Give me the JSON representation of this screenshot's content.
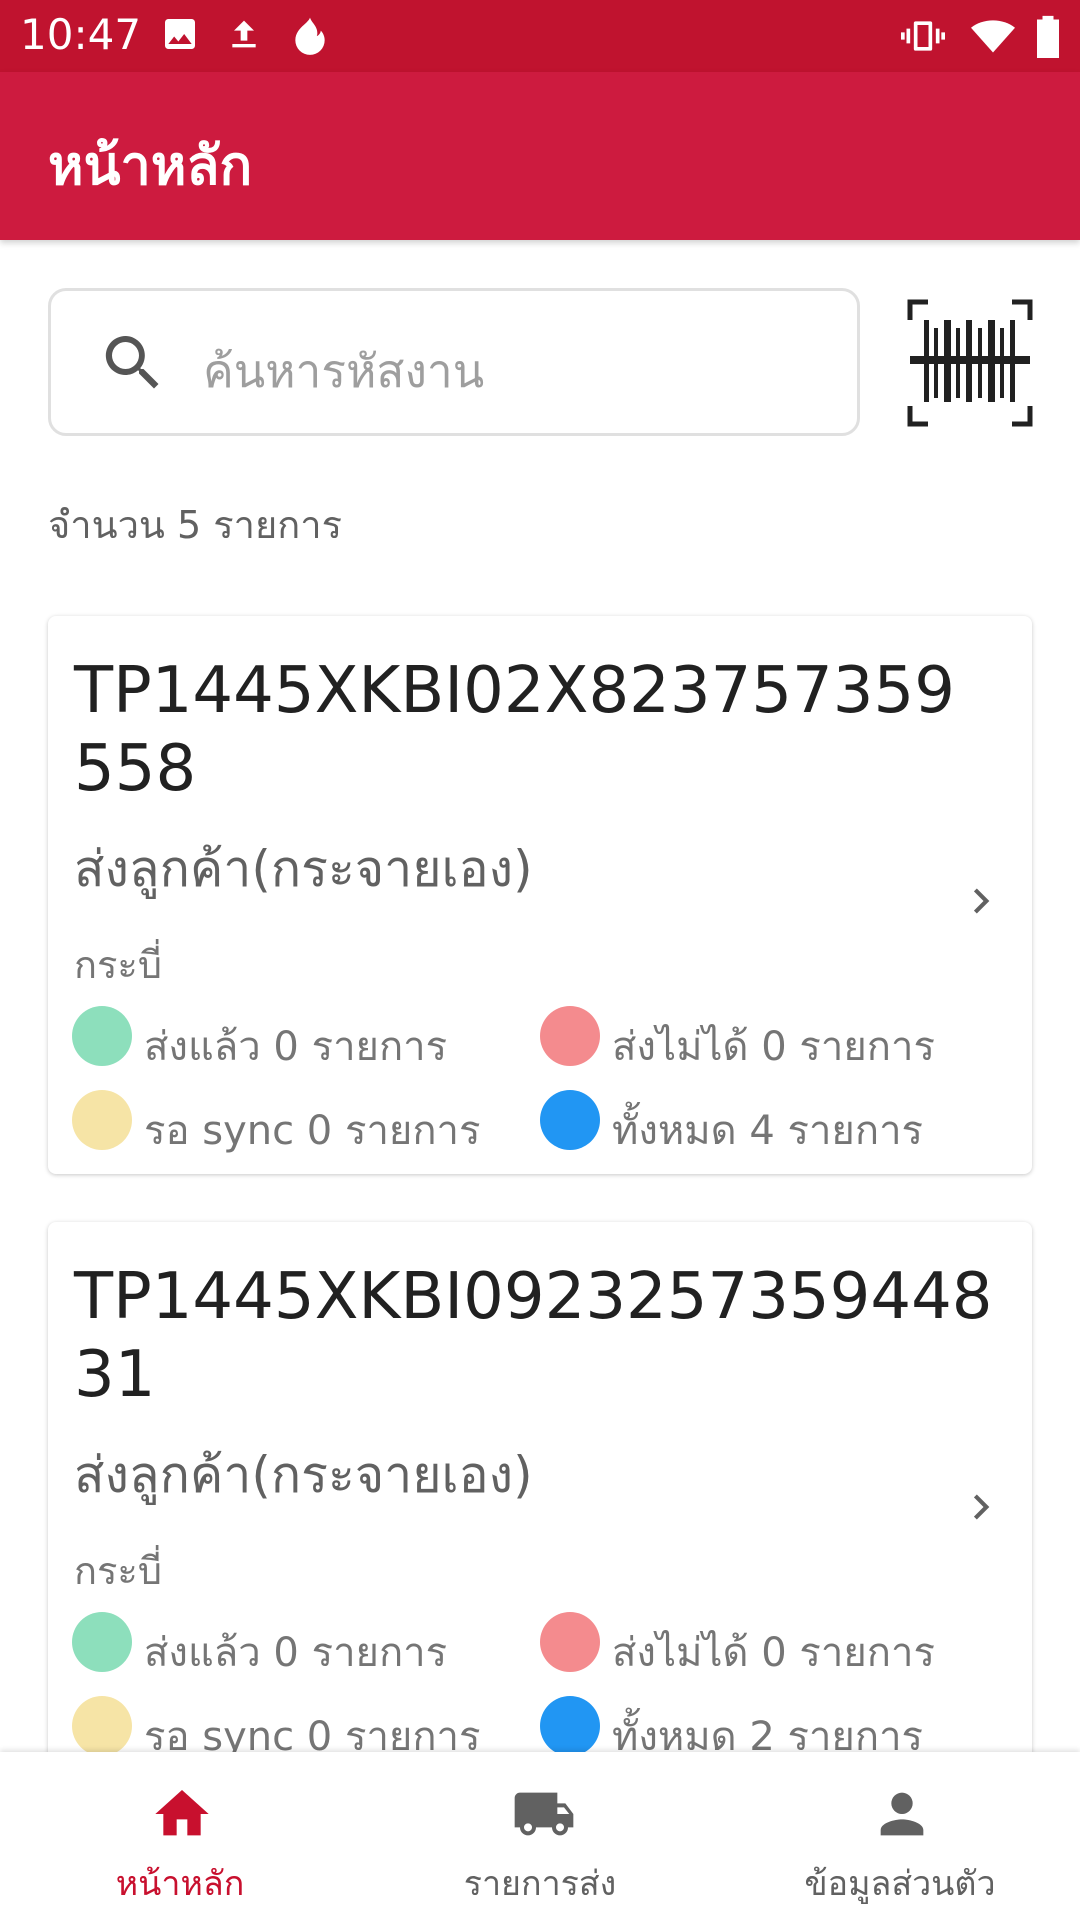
{
  "status_bar": {
    "time": "10:47"
  },
  "app_bar": {
    "title": "หน้าหลัก"
  },
  "search": {
    "placeholder": "ค้นหารหัสงาน"
  },
  "summary": {
    "count_label": "จำนวน 5 รายการ"
  },
  "colors": {
    "primary": "#cd1b3f",
    "status_bar": "#c0132f",
    "delivered": "#8ddfbc",
    "failed": "#f48b8e",
    "pending_sync": "#f6e4a6",
    "total": "#2196f3"
  },
  "cards": [
    {
      "code": "TP1445XKBI02X823757359558",
      "type": "ส่งลูกค้า(กระจายเอง)",
      "area": "กระบี่",
      "stats": {
        "delivered": "ส่งแล้ว 0 รายการ",
        "failed": "ส่งไม่ได้ 0 รายการ",
        "pending_sync": "รอ sync 0 รายการ",
        "total": "ทั้งหมด 4 รายการ"
      }
    },
    {
      "code": "TP1445XKBI092325735944831",
      "type": "ส่งลูกค้า(กระจายเอง)",
      "area": "กระบี่",
      "stats": {
        "delivered": "ส่งแล้ว 0 รายการ",
        "failed": "ส่งไม่ได้ 0 รายการ",
        "pending_sync": "รอ sync 0 รายการ",
        "total": "ทั้งหมด 2 รายการ"
      }
    }
  ],
  "bottom_nav": {
    "items": [
      {
        "label": "หน้าหลัก",
        "icon": "home-icon",
        "active": true
      },
      {
        "label": "รายการส่ง",
        "icon": "truck-icon",
        "active": false
      },
      {
        "label": "ข้อมูลส่วนตัว",
        "icon": "person-icon",
        "active": false
      }
    ]
  }
}
